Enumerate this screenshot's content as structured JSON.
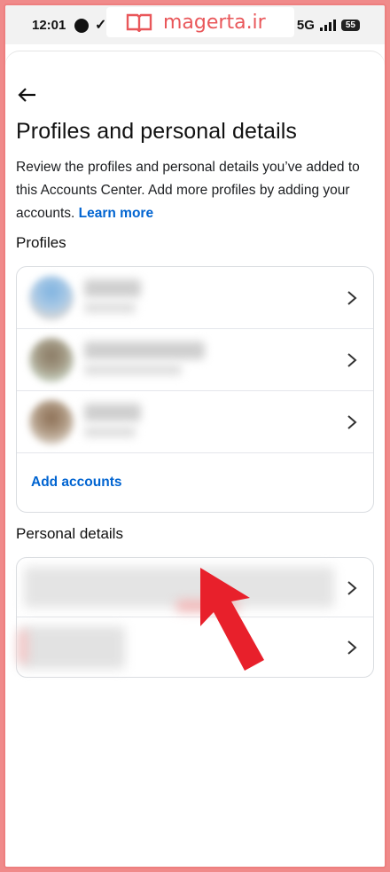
{
  "status": {
    "time": "12:01",
    "network": "5G",
    "battery": "55"
  },
  "watermark": {
    "text": "magerta.ir"
  },
  "header": {
    "title": "Profiles and personal details",
    "description": "Review the profiles and personal details you’ve added to this Accounts Center. Add more profiles by adding your accounts.",
    "learn_more": "Learn more"
  },
  "profiles": {
    "label": "Profiles",
    "add_accounts": "Add accounts"
  },
  "personal_details": {
    "label": "Personal details"
  },
  "colors": {
    "link": "#0064d1",
    "border_frame": "#ee7f7f",
    "annotation_arrow": "#e8202b"
  }
}
